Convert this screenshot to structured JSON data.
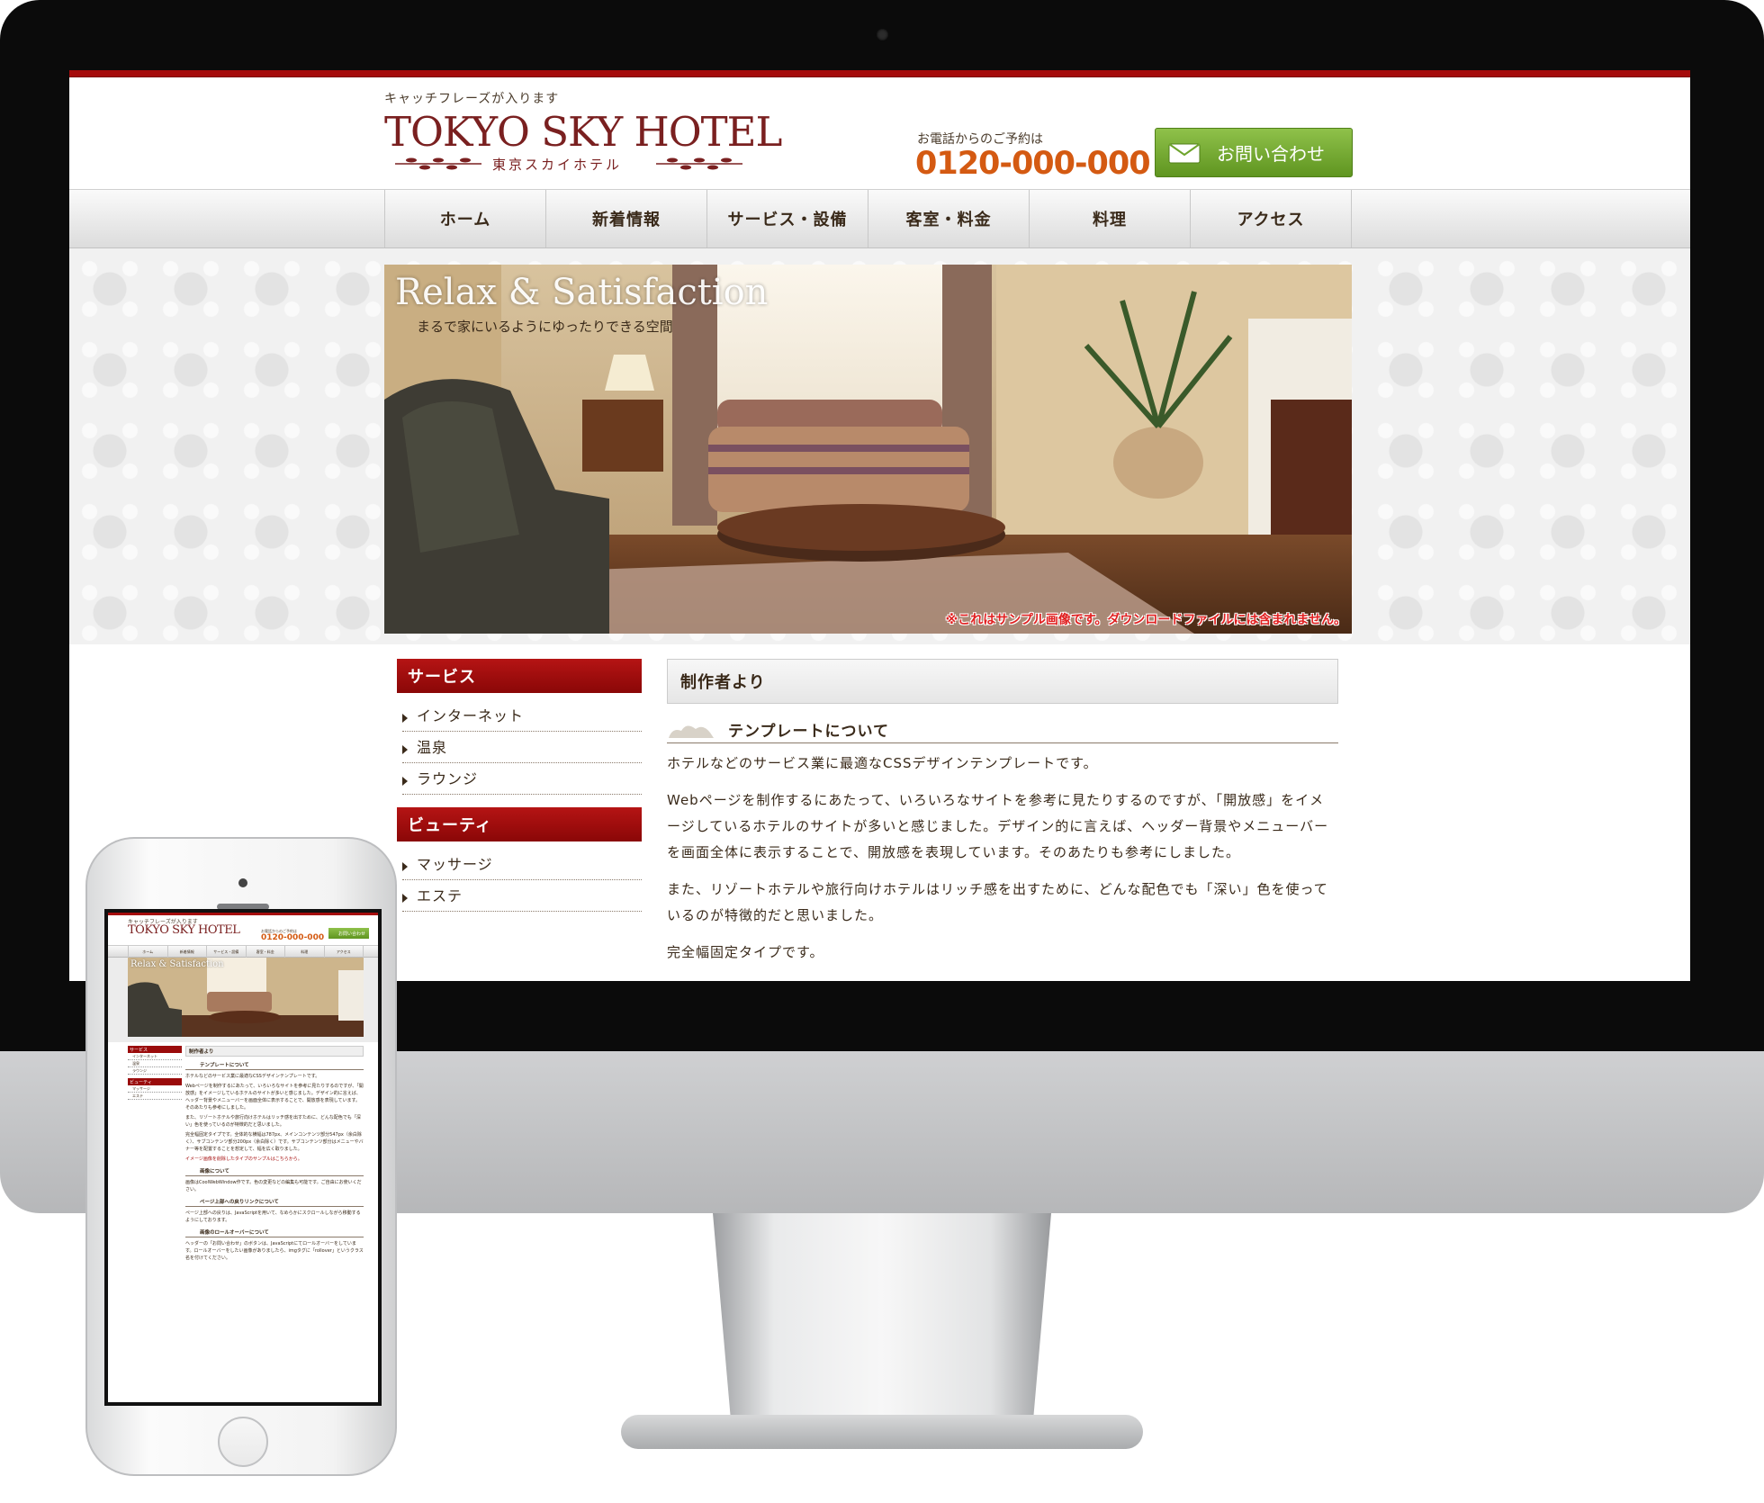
{
  "site": {
    "tagline": "キャッチフレーズが入ります",
    "logo_main": "TOKYO SKY HOTEL",
    "logo_sub": "東京スカイホテル",
    "phone_label": "お電話からのご予約は",
    "phone_number": "0120-000-000",
    "contact_button": "お問い合わせ"
  },
  "nav": [
    "ホーム",
    "新着情報",
    "サービス・設備",
    "客室・料金",
    "料理",
    "アクセス"
  ],
  "hero": {
    "title": "Relax & Satisfaction",
    "subtitle": "まるで家にいるようにゆったりできる空間",
    "notice": "※これはサンプル画像です。ダウンロードファイルには含まれません。"
  },
  "sidebar": [
    {
      "heading": "サービス",
      "items": [
        "インターネット",
        "温泉",
        "ラウンジ"
      ]
    },
    {
      "heading": "ビューティ",
      "items": [
        "マッサージ",
        "エステ"
      ]
    }
  ],
  "main": {
    "heading": "制作者より",
    "section_title": "テンプレートについて",
    "paragraphs": [
      "ホテルなどのサービス業に最適なCSSデザインテンプレートです。",
      "Webページを制作するにあたって、いろいろなサイトを参考に見たりするのですが、「開放感」をイメージしているホテルのサイトが多いと感じました。デザイン的に言えば、ヘッダー背景やメニューバーを画面全体に表示することで、開放感を表現しています。そのあたりも参考にしました。",
      "また、リゾートホテルや旅行向けホテルはリッチ感を出すために、どんな配色でも「深い」色を使っているのが特徴的だと思いました。",
      "完全幅固定タイプです。"
    ]
  },
  "mobile": {
    "tagline": "キャッチフレーズが入ります",
    "logo_main": "TOKYO SKY HOTEL",
    "phone_label": "お電話からのご予約は",
    "phone_number": "0120-000-000",
    "contact_button": "お問い合わせ",
    "nav": [
      "ホーム",
      "新着情報",
      "サービス・設備",
      "客室・料金",
      "料理",
      "アクセス"
    ],
    "hero_title": "Relax & Satisfaction",
    "sidebar": [
      {
        "heading": "サービス",
        "items": [
          "インターネット",
          "温泉",
          "ラウンジ"
        ]
      },
      {
        "heading": "ビューティ",
        "items": [
          "マッサージ",
          "エステ"
        ]
      }
    ],
    "main_heading": "制作者より",
    "sections": [
      {
        "title": "テンプレートについて",
        "paragraphs": [
          "ホテルなどのサービス業に最適なCSSデザインテンプレートです。",
          "Webページを制作するにあたって、いろいろなサイトを参考に見たりするのですが、「開放感」をイメージしているホテルのサイトが多いと感じました。デザイン的に言えば、ヘッダー背景やメニューバーを画面全体に表示することで、開放感を表現しています。そのあたりも参考にしました。",
          "また、リゾートホテルや旅行向けホテルはリッチ感を出すために、どんな配色でも「深い」色を使っているのが特徴的だと思いました。",
          "完全幅固定タイプです。全体的な横幅は787px、メインコンテンツ部分547px（余白除く）、サブコンテンツ部分200px（余白除く）です。サブコンテンツ部分はメニューやバナー等を配置することを想定して、幅を広く取りました。"
        ],
        "link": "イメージ画像を削除したタイプのサンプルはこちらから。"
      },
      {
        "title": "画像について",
        "paragraphs": [
          "画像はCoolWebWindow作です。色の変更などの編集も可能です。ご自由にお使いください。"
        ]
      },
      {
        "title": "ページ上部への戻りリンクについて",
        "paragraphs": [
          "ページ上部への戻りは、JavaScriptを用いて、なめらかにスクロールしながら移動するようにしております。"
        ]
      },
      {
        "title": "画像のロールオーバーについて",
        "paragraphs": [
          "ヘッダーの「お問い合わせ」のボタンは、JavaScriptにてロールオーバーをしています。ロールオーバーをしたい画像がありましたら、imgタグに「rollover」というクラス名を付けてください。"
        ]
      }
    ]
  },
  "colors": {
    "accent": "#a50c0c",
    "phone": "#d45a12",
    "contact_green": "#6ea42c",
    "text": "#3a2a1a"
  }
}
